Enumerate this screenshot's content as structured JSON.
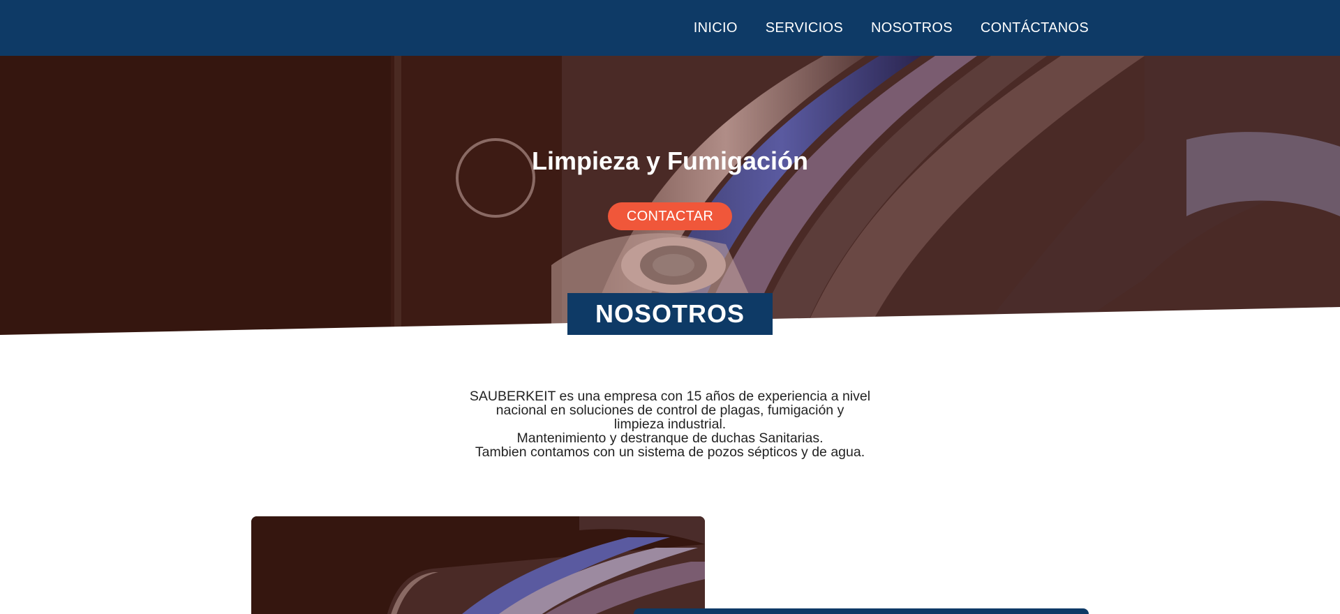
{
  "nav": {
    "items": [
      "INICIO",
      "SERVICIOS",
      "NOSOTROS",
      "CONTÁCTANOS"
    ]
  },
  "hero": {
    "title": "Limpieza y Fumigación",
    "button_label": "CONTACTAR"
  },
  "section": {
    "title": "NOSOTROS"
  },
  "about": {
    "lines": [
      "SAUBERKEIT es una empresa con 15 años de experiencia a nivel",
      "nacional en soluciones de control de plagas, fumigación y",
      "limpieza industrial.",
      "Mantenimiento y destranque de duchas Sanitarias.",
      "Tambien contamos con un sistema de pozos sépticos y de agua."
    ]
  },
  "colors": {
    "nav_bg": "#0e3a66",
    "accent": "#f0573a",
    "hero_overlay": "#35160f"
  }
}
